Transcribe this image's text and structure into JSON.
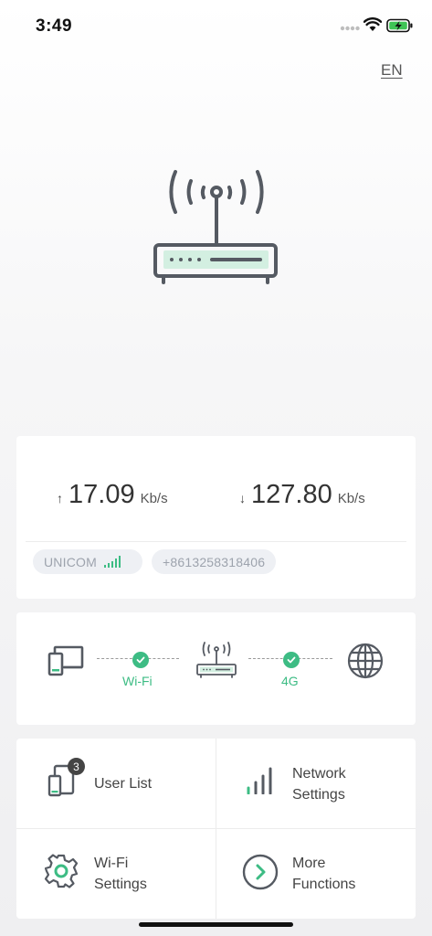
{
  "status_bar": {
    "time": "3:49"
  },
  "header": {
    "language": "EN"
  },
  "speed": {
    "upload": {
      "value": "17.09",
      "unit": "Kb/s"
    },
    "download": {
      "value": "127.80",
      "unit": "Kb/s"
    },
    "carrier": "UNICOM",
    "phone_number": "+8613258318406"
  },
  "connection": {
    "wifi_label": "Wi-Fi",
    "cellular_label": "4G"
  },
  "menu": {
    "user_list": {
      "label": "User List",
      "badge": "3"
    },
    "network_settings": {
      "line1": "Network",
      "line2": "Settings"
    },
    "wifi_settings": {
      "line1": "Wi-Fi",
      "line2": "Settings"
    },
    "more_functions": {
      "line1": "More",
      "line2": "Functions"
    }
  },
  "colors": {
    "accent": "#3dbc84",
    "icon_dark": "#555a62"
  }
}
